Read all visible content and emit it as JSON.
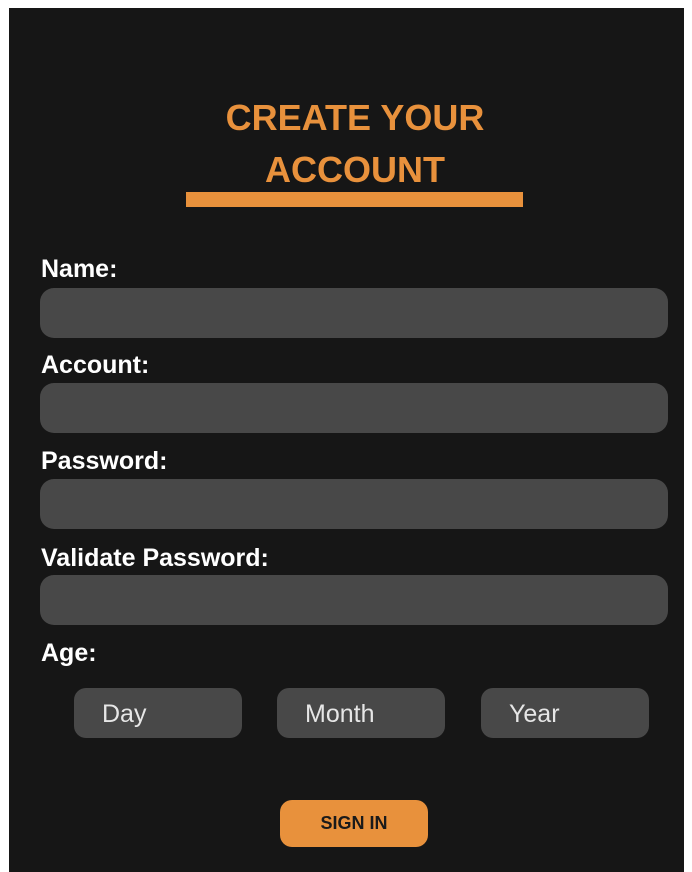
{
  "header": {
    "title_line1": "CREATE YOUR",
    "title_line2": "ACCOUNT"
  },
  "form": {
    "name_label": "Name:",
    "name_value": "",
    "account_label": "Account:",
    "account_value": "",
    "password_label": "Password:",
    "password_value": "",
    "validate_password_label": "Validate Password:",
    "validate_password_value": "",
    "age_label": "Age:",
    "age": {
      "day": "Day",
      "month": "Month",
      "year": "Year"
    },
    "submit_label": "SIGN IN"
  },
  "colors": {
    "accent": "#e8913c",
    "background": "#161616",
    "field": "#484848",
    "text": "#ffffff"
  }
}
